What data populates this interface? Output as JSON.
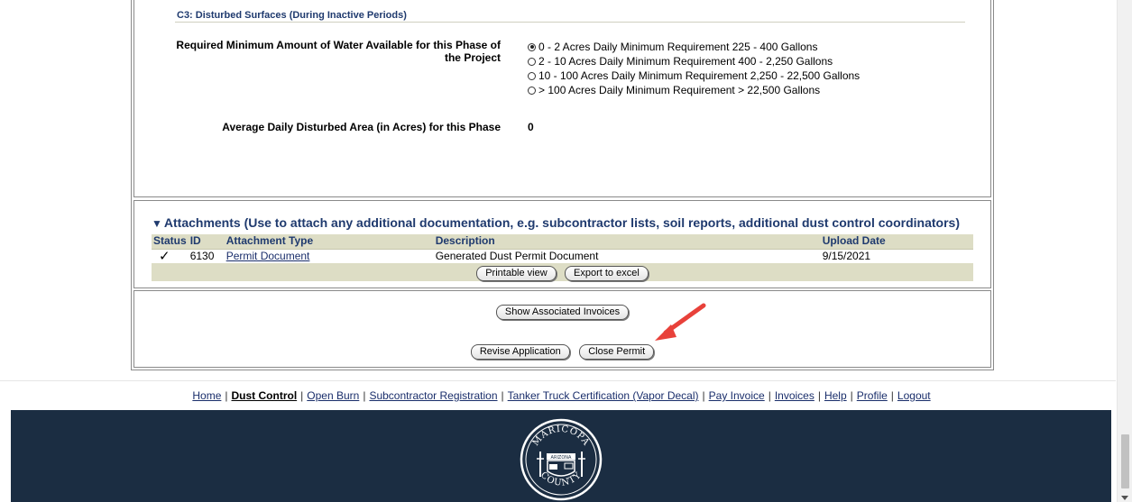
{
  "section": {
    "title": "C3: Disturbed Surfaces (During Inactive Periods)"
  },
  "water": {
    "label_line1": "Required Minimum Amount of Water Available for this Phase of",
    "label_line2": "the Project",
    "options": [
      {
        "label": "0 - 2 Acres Daily Minimum Requirement 225 - 400 Gallons",
        "selected": true
      },
      {
        "label": "2 - 10 Acres Daily Minimum Requirement 400 - 2,250 Gallons",
        "selected": false
      },
      {
        "label": "10 - 100 Acres Daily Minimum Requirement 2,250 - 22,500 Gallons",
        "selected": false
      },
      {
        "label": "> 100 Acres Daily Minimum Requirement > 22,500 Gallons",
        "selected": false
      }
    ]
  },
  "area": {
    "label": "Average Daily Disturbed Area (in Acres) for this Phase",
    "value": "0"
  },
  "attachments": {
    "title": "Attachments (Use to attach any additional documentation, e.g. subcontractor lists, soil reports, additional dust control coordinators)",
    "columns": {
      "status": "Status",
      "id": "ID",
      "type": "Attachment Type",
      "description": "Description",
      "upload_date": "Upload Date"
    },
    "rows": [
      {
        "status": "✓",
        "id": "6130",
        "type": "Permit Document",
        "description": "Generated Dust Permit Document",
        "upload_date": "9/15/2021"
      }
    ],
    "printable_label": "Printable view",
    "export_label": "Export to excel"
  },
  "actions": {
    "show_invoices": "Show Associated Invoices",
    "revise": "Revise Application",
    "close_permit": "Close Permit"
  },
  "annotation": {
    "arrow_color": "#e8413a"
  },
  "footer_nav": [
    {
      "label": "Home",
      "current": false
    },
    {
      "label": "Dust Control",
      "current": true
    },
    {
      "label": "Open Burn",
      "current": false
    },
    {
      "label": "Subcontractor Registration",
      "current": false
    },
    {
      "label": "Tanker Truck Certification (Vapor Decal)",
      "current": false
    },
    {
      "label": "Pay Invoice",
      "current": false
    },
    {
      "label": "Invoices",
      "current": false
    },
    {
      "label": "Help",
      "current": false
    },
    {
      "label": "Profile",
      "current": false
    },
    {
      "label": "Logout",
      "current": false
    }
  ],
  "seal": {
    "top_text": "MARICOPA",
    "state_text": "ARIZONA",
    "bottom_text": "COUNTY"
  },
  "colors": {
    "heading_blue": "#1f3a6e",
    "table_header_bg": "#ddddc5",
    "banner_bg": "#1b2d42"
  }
}
